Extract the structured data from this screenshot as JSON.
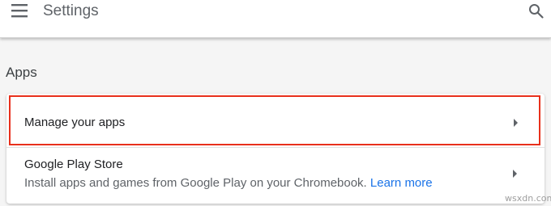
{
  "header": {
    "title": "Settings",
    "menu_icon": "hamburger-menu-icon",
    "search_icon": "search-icon"
  },
  "section": {
    "title": "Apps"
  },
  "card": {
    "manage": {
      "label": "Manage your apps",
      "highlight_color": "#e8301c"
    },
    "play_store": {
      "title": "Google Play Store",
      "description": "Install apps and games from Google Play on your Chromebook.",
      "link_text": "Learn more",
      "link_color": "#1a73e8"
    }
  },
  "watermark": "wsxdn.com"
}
